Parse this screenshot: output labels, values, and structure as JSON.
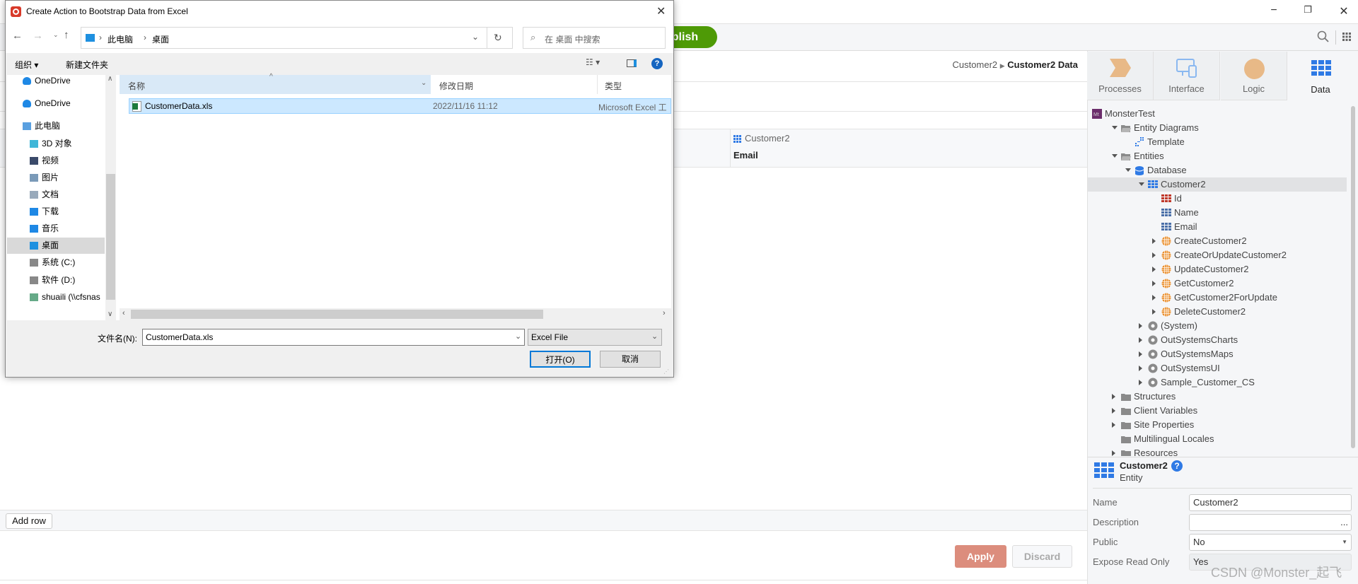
{
  "app": {
    "window_controls": {
      "minimize": "−",
      "maximize": "❐",
      "close": "✕"
    },
    "toolbar": {
      "publish_label": "ublish",
      "search_icon": "search-icon",
      "apps_icon": "grid-icon"
    },
    "breadcrumb": {
      "parent": "Customer2",
      "current": "Customer2 Data"
    },
    "grid": {
      "entity_label": "Customer2",
      "column": "Email"
    },
    "add_row_label": "Add row",
    "apply_label": "Apply",
    "discard_label": "Discard",
    "colors": {
      "publish": "#4e9a06",
      "apply": "#dc8d7d",
      "accent": "#2f7ae5",
      "action": "#e8871e"
    }
  },
  "panel": {
    "tabs": [
      {
        "label": "Processes",
        "icon": "process-chevron-icon"
      },
      {
        "label": "Interface",
        "icon": "devices-icon"
      },
      {
        "label": "Logic",
        "icon": "circle-icon"
      },
      {
        "label": "Data",
        "icon": "table-icon",
        "active": true
      }
    ],
    "tree": [
      {
        "label": "MonsterTest",
        "level": 0,
        "icon": "module",
        "arrow": "none"
      },
      {
        "label": "Entity Diagrams",
        "level": 1,
        "icon": "folder-open",
        "arrow": "open"
      },
      {
        "label": "Template",
        "level": 2,
        "icon": "diagram",
        "arrow": "none"
      },
      {
        "label": "Entities",
        "level": 1,
        "icon": "folder-open",
        "arrow": "open"
      },
      {
        "label": "Database",
        "level": 2,
        "icon": "database",
        "arrow": "open"
      },
      {
        "label": "Customer2",
        "level": 3,
        "icon": "entity",
        "arrow": "open",
        "selected": true
      },
      {
        "label": "Id",
        "level": 4,
        "icon": "attr-id",
        "arrow": "none"
      },
      {
        "label": "Name",
        "level": 4,
        "icon": "attr",
        "arrow": "none"
      },
      {
        "label": "Email",
        "level": 4,
        "icon": "attr",
        "arrow": "none"
      },
      {
        "label": "CreateCustomer2",
        "level": 4,
        "icon": "action",
        "arrow": "closed"
      },
      {
        "label": "CreateOrUpdateCustomer2",
        "level": 4,
        "icon": "action",
        "arrow": "closed"
      },
      {
        "label": "UpdateCustomer2",
        "level": 4,
        "icon": "action",
        "arrow": "closed"
      },
      {
        "label": "GetCustomer2",
        "level": 4,
        "icon": "action",
        "arrow": "closed"
      },
      {
        "label": "GetCustomer2ForUpdate",
        "level": 4,
        "icon": "action",
        "arrow": "closed"
      },
      {
        "label": "DeleteCustomer2",
        "level": 4,
        "icon": "action",
        "arrow": "closed"
      },
      {
        "label": "(System)",
        "level": 3,
        "icon": "dependency",
        "arrow": "closed"
      },
      {
        "label": "OutSystemsCharts",
        "level": 3,
        "icon": "dependency",
        "arrow": "closed"
      },
      {
        "label": "OutSystemsMaps",
        "level": 3,
        "icon": "dependency",
        "arrow": "closed"
      },
      {
        "label": "OutSystemsUI",
        "level": 3,
        "icon": "dependency",
        "arrow": "closed"
      },
      {
        "label": "Sample_Customer_CS",
        "level": 3,
        "icon": "dependency",
        "arrow": "closed"
      },
      {
        "label": "Structures",
        "level": 1,
        "icon": "folder",
        "arrow": "closed"
      },
      {
        "label": "Client Variables",
        "level": 1,
        "icon": "folder",
        "arrow": "closed"
      },
      {
        "label": "Site Properties",
        "level": 1,
        "icon": "folder",
        "arrow": "closed"
      },
      {
        "label": "Multilingual Locales",
        "level": 1,
        "icon": "folder",
        "arrow": "none"
      },
      {
        "label": "Resources",
        "level": 1,
        "icon": "folder",
        "arrow": "closed"
      }
    ],
    "properties": {
      "title": "Customer2",
      "subtitle": "Entity",
      "name_label": "Name",
      "name_value": "Customer2",
      "description_label": "Description",
      "description_value": "",
      "description_more": "...",
      "public_label": "Public",
      "public_value": "No",
      "expose_label": "Expose Read Only",
      "expose_value": "Yes"
    }
  },
  "dialog": {
    "title": "Create Action to Bootstrap Data from Excel",
    "close": "✕",
    "address": [
      "此电脑",
      "桌面"
    ],
    "search_placeholder": "在 桌面 中搜索",
    "organize_label": "组织 ▾",
    "new_folder_label": "新建文件夹",
    "nav": [
      {
        "label": "OneDrive",
        "icon": "cloud",
        "level": 0
      },
      {
        "label": "OneDrive",
        "icon": "cloud",
        "level": 0
      },
      {
        "label": "此电脑",
        "icon": "computer",
        "level": 0
      },
      {
        "label": "3D 对象",
        "icon": "cube",
        "level": 1
      },
      {
        "label": "视频",
        "icon": "video",
        "level": 1
      },
      {
        "label": "图片",
        "icon": "picture",
        "level": 1
      },
      {
        "label": "文档",
        "icon": "document",
        "level": 1
      },
      {
        "label": "下载",
        "icon": "download",
        "level": 1
      },
      {
        "label": "音乐",
        "icon": "music",
        "level": 1
      },
      {
        "label": "桌面",
        "icon": "desktop",
        "level": 1,
        "selected": true
      },
      {
        "label": "系统 (C:)",
        "icon": "drive",
        "level": 1
      },
      {
        "label": "软件 (D:)",
        "icon": "drive",
        "level": 1
      },
      {
        "label": "shuaili (\\\\cfsnas",
        "icon": "network-drive",
        "level": 1
      }
    ],
    "columns": [
      "名称",
      "修改日期",
      "类型"
    ],
    "files": [
      {
        "name": "CustomerData.xls",
        "modified": "2022/11/16 11:12",
        "type": "Microsoft Excel 工"
      }
    ],
    "filename_label": "文件名(N):",
    "filename_value": "CustomerData.xls",
    "filter_value": "Excel File",
    "open_label": "打开(O)",
    "cancel_label": "取消"
  },
  "watermark": "CSDN @Monster_起飞"
}
